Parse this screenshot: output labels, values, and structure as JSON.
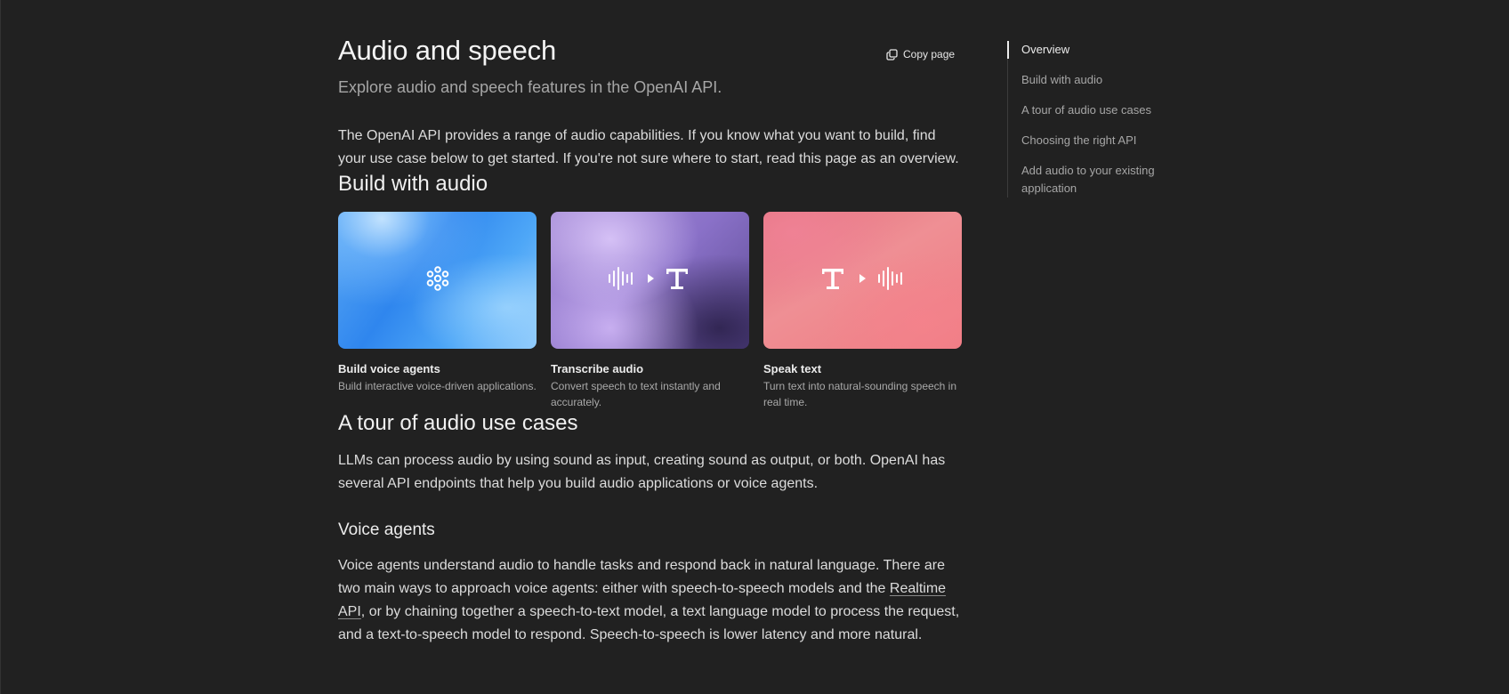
{
  "header": {
    "title": "Audio and speech",
    "subtitle": "Explore audio and speech features in the OpenAI API.",
    "copy_page_label": "Copy page"
  },
  "intro": "The OpenAI API provides a range of audio capabilities. If you know what you want to build, find your use case below to get started. If you're not sure where to start, read this page as an overview.",
  "build_section": {
    "heading": "Build with audio",
    "cards": [
      {
        "title": "Build voice agents",
        "description": "Build interactive voice-driven applications.",
        "icon": "voice-agent-icon"
      },
      {
        "title": "Transcribe audio",
        "description": "Convert speech to text instantly and accurately.",
        "icon": "speech-to-text-icon"
      },
      {
        "title": "Speak text",
        "description": "Turn text into natural-sounding speech in real time.",
        "icon": "text-to-speech-icon"
      }
    ]
  },
  "tour_section": {
    "heading": "A tour of audio use cases",
    "text": "LLMs can process audio by using sound as input, creating sound as output, or both. OpenAI has several API endpoints that help you build audio applications or voice agents.",
    "voice_agents": {
      "heading": "Voice agents",
      "text_before_link": "Voice agents understand audio to handle tasks and respond back in natural language. There are two main ways to approach voice agents: either with speech-to-speech models and the ",
      "link_text": "Realtime API",
      "text_after_link": ", or by chaining together a speech-to-text model, a text language model to process the request, and a text-to-speech model to respond. Speech-to-speech is lower latency and more natural."
    }
  },
  "toc": {
    "items": [
      {
        "label": "Overview",
        "active": true
      },
      {
        "label": "Build with audio",
        "active": false
      },
      {
        "label": "A tour of audio use cases",
        "active": false
      },
      {
        "label": "Choosing the right API",
        "active": false
      },
      {
        "label": "Add audio to your existing application",
        "active": false
      }
    ]
  },
  "colors": {
    "background": "#212121",
    "text": "#ececec",
    "muted": "#a6a6a6"
  }
}
